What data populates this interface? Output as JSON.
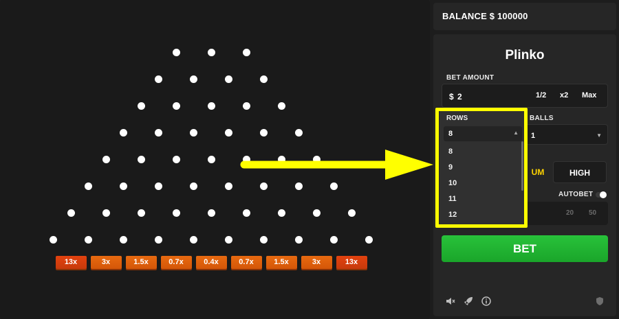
{
  "balance": {
    "label": "BALANCE $ 100000"
  },
  "game": {
    "title": "Plinko",
    "bet_amount_label": "BET AMOUNT",
    "bet_currency": "$",
    "bet_value": "2",
    "bet_half": "1/2",
    "bet_double": "x2",
    "bet_max": "Max",
    "rows_label": "ROWS",
    "balls_label": "BALLS",
    "balls_value": "1",
    "risk_medium_partial": "UM",
    "risk_high": "HIGH",
    "autobet_label": "AUTOBET",
    "count_options": [
      "20",
      "50"
    ],
    "bet_button": "BET"
  },
  "rows_dropdown": {
    "selected": "8",
    "options": [
      "8",
      "9",
      "10",
      "11",
      "12"
    ]
  },
  "board": {
    "peg_rows": [
      3,
      4,
      5,
      6,
      7,
      8,
      9,
      10
    ],
    "multipliers": [
      "13x",
      "3x",
      "1.5x",
      "0.7x",
      "0.4x",
      "0.7x",
      "1.5x",
      "3x",
      "13x"
    ]
  },
  "colors": {
    "highlight": "#ffff00",
    "bet_button": "#22b433",
    "slot": "#e2640c",
    "risk_active": "#ffd400"
  },
  "icons": [
    "mute-icon",
    "rocket-icon",
    "info-icon",
    "shield-icon"
  ]
}
